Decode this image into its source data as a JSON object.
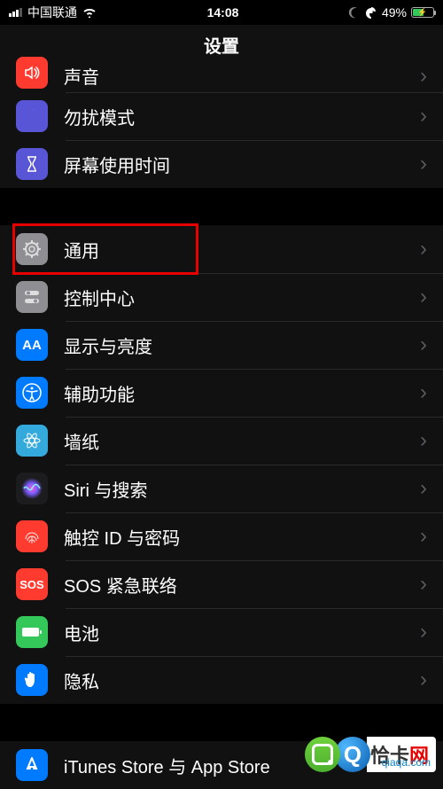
{
  "status_bar": {
    "carrier": "中国联通",
    "time": "14:08",
    "battery_percent": "49%"
  },
  "header": {
    "title": "设置"
  },
  "groups": [
    {
      "rows": [
        {
          "id": "sound",
          "label": "声音",
          "cutoff": true
        },
        {
          "id": "dnd",
          "label": "勿扰模式"
        },
        {
          "id": "screentime",
          "label": "屏幕使用时间"
        }
      ]
    },
    {
      "rows": [
        {
          "id": "general",
          "label": "通用",
          "highlighted": true
        },
        {
          "id": "control",
          "label": "控制中心"
        },
        {
          "id": "display",
          "label": "显示与亮度"
        },
        {
          "id": "access",
          "label": "辅助功能"
        },
        {
          "id": "wall",
          "label": "墙纸"
        },
        {
          "id": "siri",
          "label": "Siri 与搜索"
        },
        {
          "id": "touchid",
          "label": "触控 ID 与密码"
        },
        {
          "id": "sos",
          "label": "SOS 紧急联络"
        },
        {
          "id": "battery",
          "label": "电池"
        },
        {
          "id": "privacy",
          "label": "隐私"
        }
      ]
    },
    {
      "rows": [
        {
          "id": "appstore",
          "label": "iTunes Store 与 App Store",
          "cutoff_bottom": true
        }
      ]
    }
  ],
  "watermark": {
    "text_black": "恰卡",
    "text_red": "网",
    "sub": "qiaqa.com"
  },
  "sos_text": "SOS"
}
